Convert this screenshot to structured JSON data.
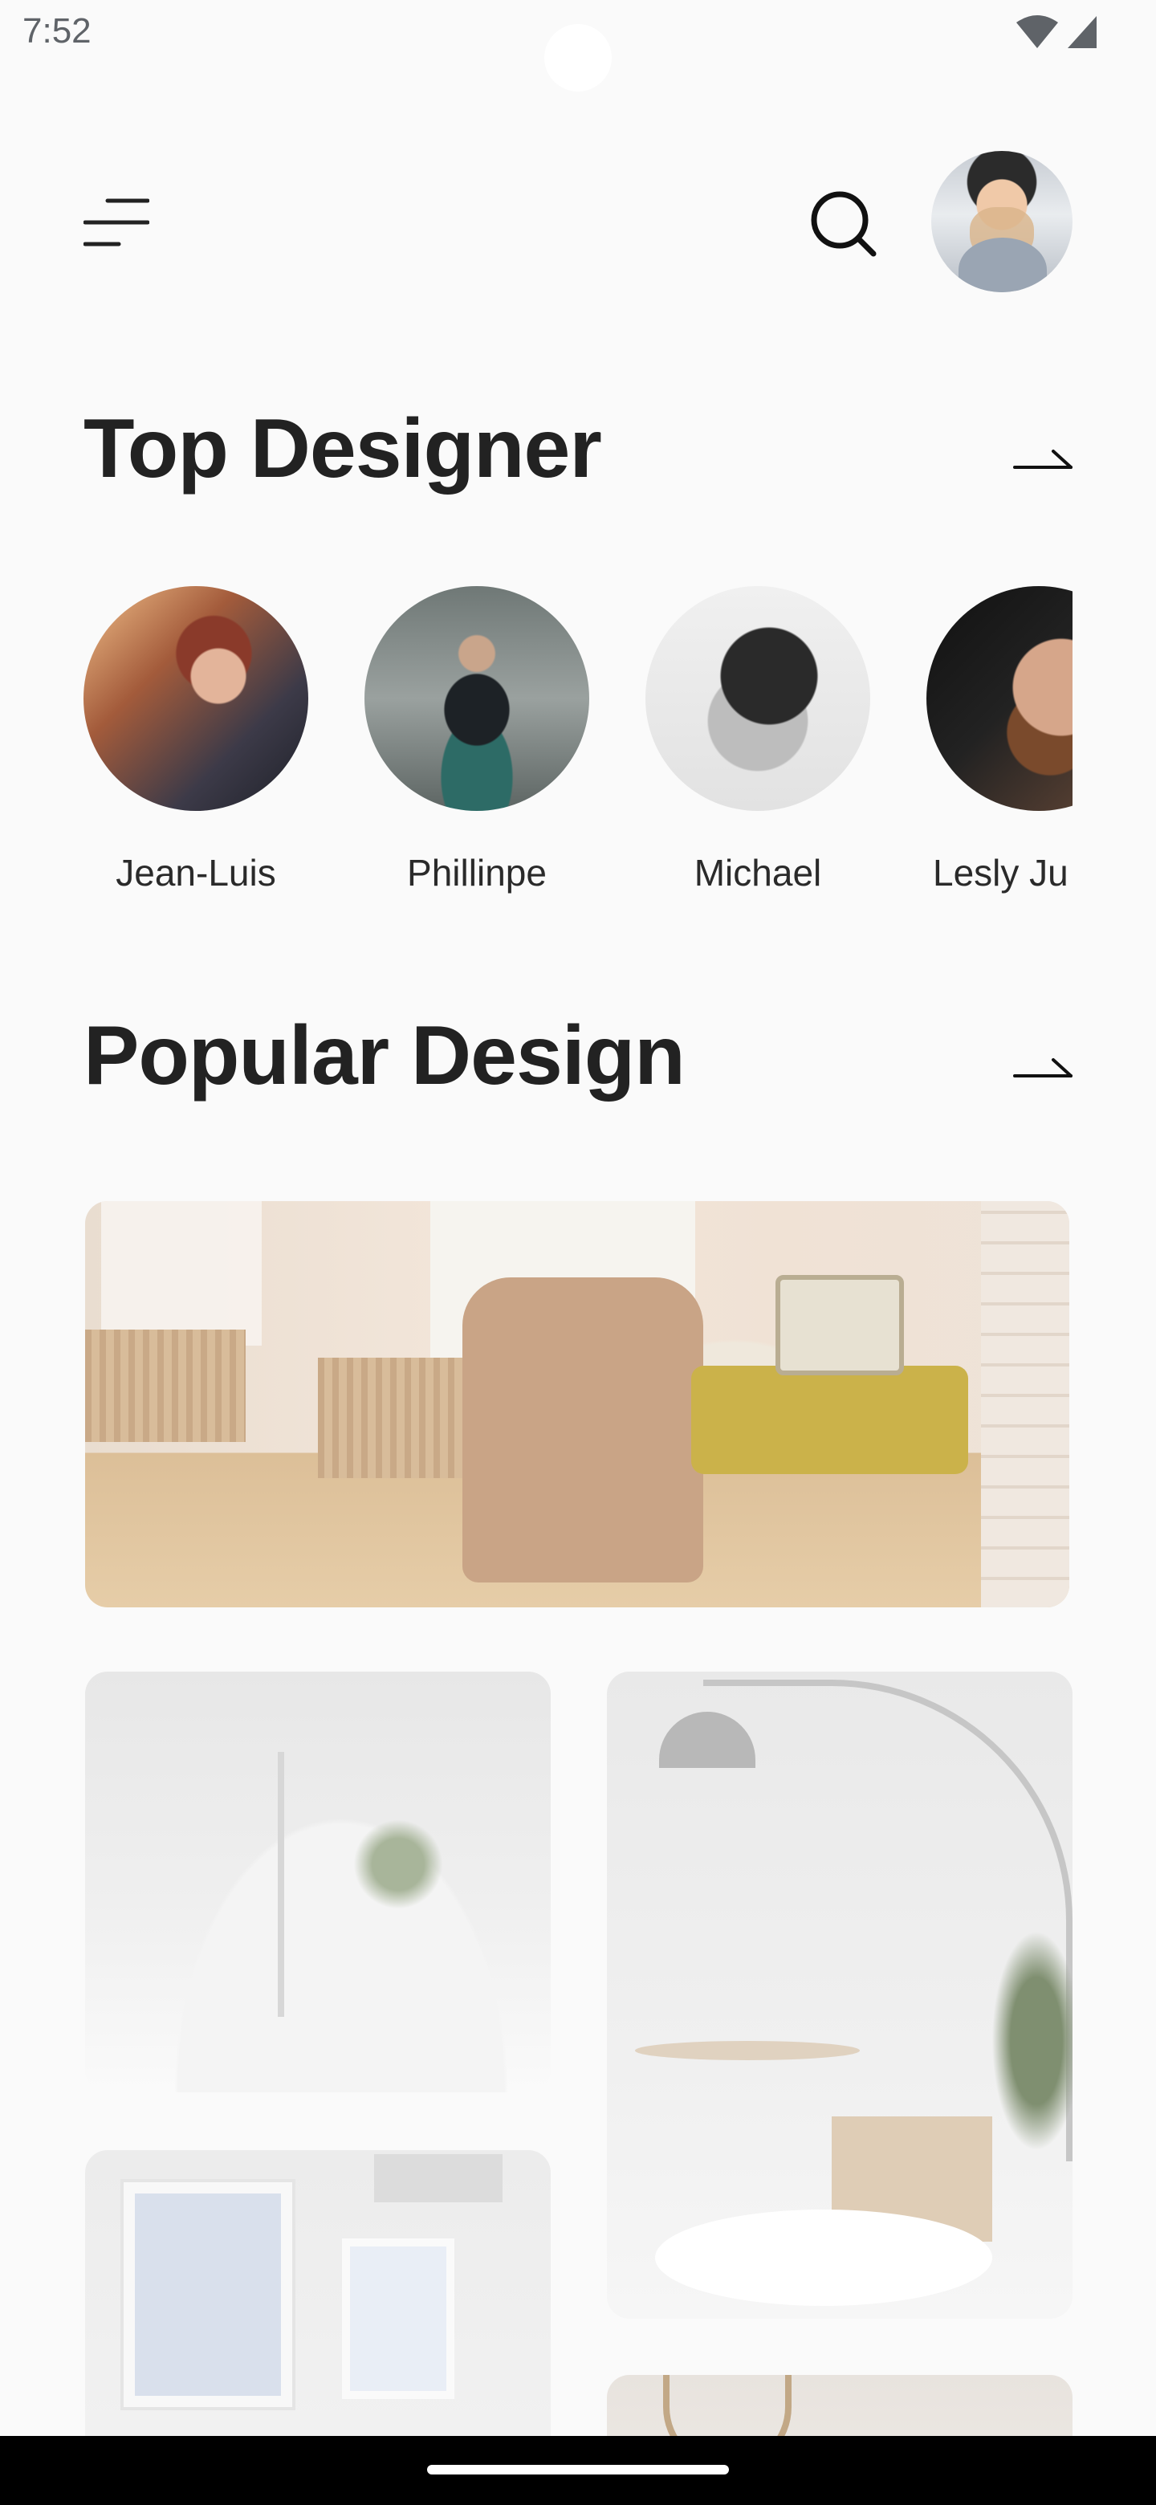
{
  "status_bar": {
    "time": "7:52",
    "wifi_icon": "wifi-icon",
    "signal_icon": "cell-signal-icon"
  },
  "header": {
    "menu_icon": "menu-icon",
    "search_icon": "search-icon",
    "avatar_icon": "avatar"
  },
  "top_designer": {
    "title": "Top Designer",
    "arrow_icon": "arrow-right-icon",
    "designers": [
      {
        "name": "Jean-Luis"
      },
      {
        "name": "Phillinpe"
      },
      {
        "name": "Michael"
      },
      {
        "name": "Lesly Ju"
      }
    ]
  },
  "popular_design": {
    "title": "Popular Design",
    "arrow_icon": "arrow-right-icon",
    "items": [
      {
        "image": "living-room-armchair"
      },
      {
        "image": "white-bedroom"
      },
      {
        "image": "dining-chair-arc-lamp"
      },
      {
        "image": "poster-wall"
      },
      {
        "image": "clock-interior"
      }
    ]
  },
  "colors": {
    "background": "#fafafa",
    "text_primary": "#222222",
    "nav_bar": "#000000"
  }
}
